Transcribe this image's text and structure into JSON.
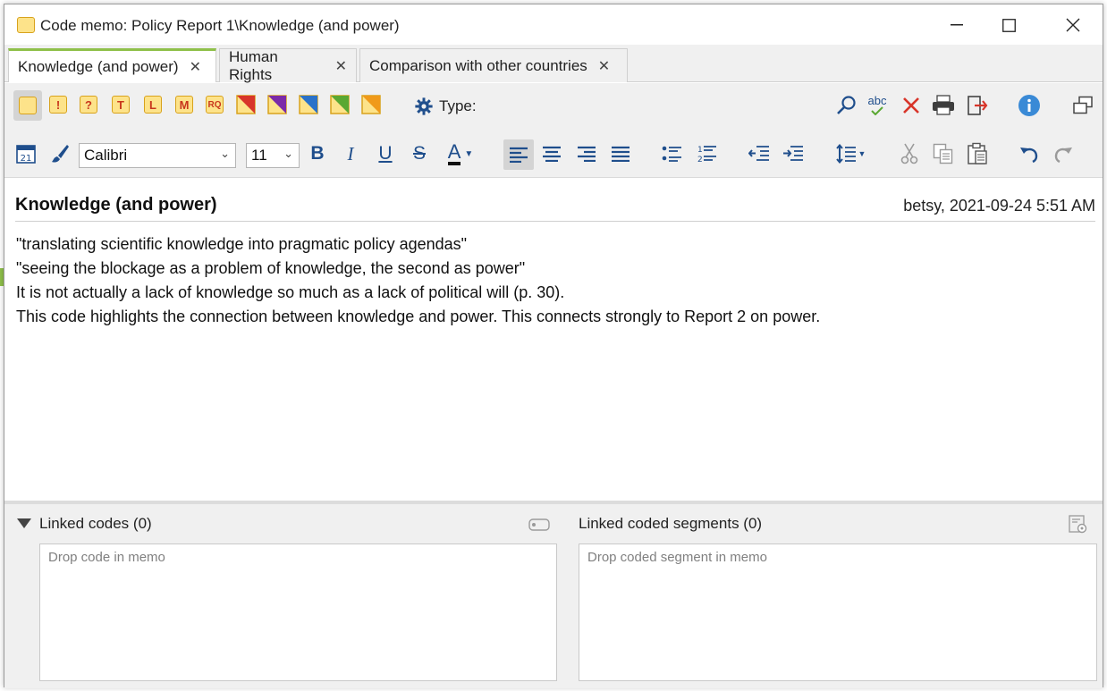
{
  "window": {
    "title": "Code memo: Policy Report 1\\Knowledge (and power)",
    "minimize": "—",
    "maximize": "☐",
    "close": "✕"
  },
  "tabs": [
    {
      "label": "Knowledge (and power)",
      "active": true
    },
    {
      "label": "Human Rights",
      "active": false
    },
    {
      "label": "Comparison with other countries",
      "active": false
    }
  ],
  "tab_close": "✕",
  "memo_types": [
    {
      "name": "standard-memo-icon",
      "glyph": ""
    },
    {
      "name": "exclamation-memo-icon",
      "glyph": "!"
    },
    {
      "name": "question-memo-icon",
      "glyph": "?"
    },
    {
      "name": "theory-memo-icon",
      "glyph": "T"
    },
    {
      "name": "literature-memo-icon",
      "glyph": "L"
    },
    {
      "name": "method-memo-icon",
      "glyph": "M"
    },
    {
      "name": "research-question-memo-icon",
      "glyph": "RQ"
    },
    {
      "name": "red-triangle-memo-icon",
      "color": "#d8352a"
    },
    {
      "name": "purple-triangle-memo-icon",
      "color": "#7b2aa8"
    },
    {
      "name": "blue-triangle-memo-icon",
      "color": "#2a72c9"
    },
    {
      "name": "green-triangle-memo-icon",
      "color": "#5aa832"
    },
    {
      "name": "orange-triangle-memo-icon",
      "color": "#f09a1a"
    }
  ],
  "toolbar": {
    "type_label": "Type:",
    "spell_label": "abc"
  },
  "format": {
    "font": "Calibri",
    "size": "11",
    "bold": "B",
    "italic": "I",
    "underline": "U",
    "strike": "S",
    "font_color": "A"
  },
  "memo": {
    "title": "Knowledge (and power)",
    "meta": "betsy, 2021-09-24 5:51 AM",
    "lines": [
      "\"translating scientific knowledge into pragmatic policy agendas\"",
      "\"seeing the blockage as a problem of knowledge, the second as power\"",
      "It is not actually a lack of knowledge so much as a lack of political will (p. 30).",
      "This code highlights the connection between knowledge and power. This connects strongly to Report 2 on power."
    ]
  },
  "linked_codes": {
    "title": "Linked codes (0)",
    "placeholder": "Drop code in memo"
  },
  "linked_segments": {
    "title": "Linked coded segments (0)",
    "placeholder": "Drop coded segment in memo"
  },
  "colors": {
    "accent_green": "#8fc04a",
    "memo_yellow": "#fde38a",
    "icon_blue": "#1f4e8c",
    "delete_red": "#d8352a"
  }
}
